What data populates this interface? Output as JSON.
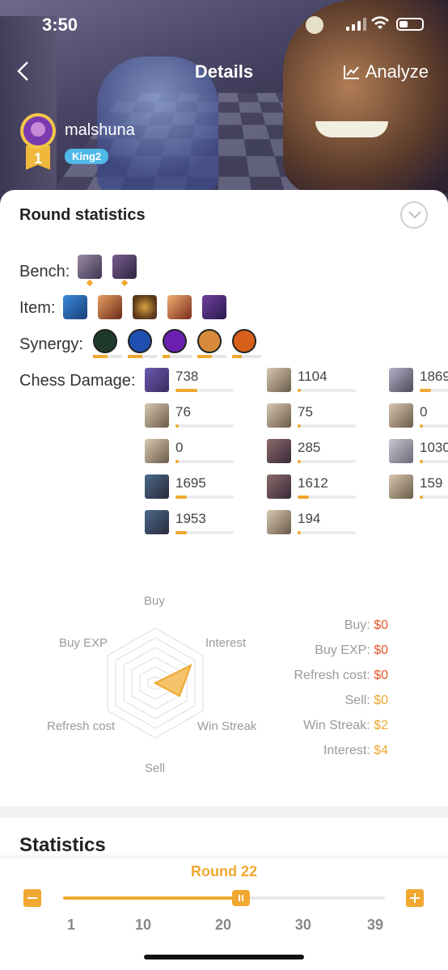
{
  "status": {
    "time": "3:50"
  },
  "nav": {
    "title": "Details",
    "analyze": "Analyze"
  },
  "user": {
    "name": "malshuna",
    "rank": "King2",
    "place": "1"
  },
  "round_stats": {
    "title": "Round statistics",
    "bench_label": "Bench:",
    "item_label": "Item:",
    "synergy_label": "Synergy:",
    "synergy_fill": [
      0.5,
      0.5,
      0.25,
      0.5,
      0.33
    ],
    "damage_label": "Chess Damage:",
    "damage": [
      {
        "value": "738",
        "fill": 0.38
      },
      {
        "value": "1104",
        "fill": 0.06
      },
      {
        "value": "1869",
        "fill": 0.2
      },
      {
        "value": "76",
        "fill": 0.06
      },
      {
        "value": "75",
        "fill": 0.06
      },
      {
        "value": "0",
        "fill": 0.05
      },
      {
        "value": "0",
        "fill": 0.05
      },
      {
        "value": "285",
        "fill": 0.06
      },
      {
        "value": "1030",
        "fill": 0.06
      },
      {
        "value": "1695",
        "fill": 0.2
      },
      {
        "value": "1612",
        "fill": 0.2
      },
      {
        "value": "159",
        "fill": 0.06
      },
      {
        "value": "1953",
        "fill": 0.2
      },
      {
        "value": "194",
        "fill": 0.06
      }
    ],
    "radar_labels": {
      "buy": "Buy",
      "interest": "Interest",
      "win_streak": "Win Streak",
      "sell": "Sell",
      "refresh": "Refresh cost",
      "buy_exp": "Buy EXP"
    },
    "economy": [
      {
        "label": "Buy:",
        "value": "$0",
        "color": "#e8552b"
      },
      {
        "label": "Buy EXP:",
        "value": "$0",
        "color": "#e8552b"
      },
      {
        "label": "Refresh cost:",
        "value": "$0",
        "color": "#e8552b"
      },
      {
        "label": "Sell:",
        "value": "$0",
        "color": "#f0a830"
      },
      {
        "label": "Win Streak:",
        "value": "$2",
        "color": "#f0a830"
      },
      {
        "label": "Interest:",
        "value": "$4",
        "color": "#f0a830"
      }
    ]
  },
  "statistics": {
    "title": "Statistics"
  },
  "slider": {
    "label": "Round 22",
    "current": 22,
    "min": 1,
    "max": 39,
    "ticks": [
      "1",
      "10",
      "20",
      "30",
      "39"
    ]
  },
  "colors": {
    "accent": "#f0a830",
    "rank_badge": "#4fb9e8",
    "cost_red": "#e8552b"
  }
}
